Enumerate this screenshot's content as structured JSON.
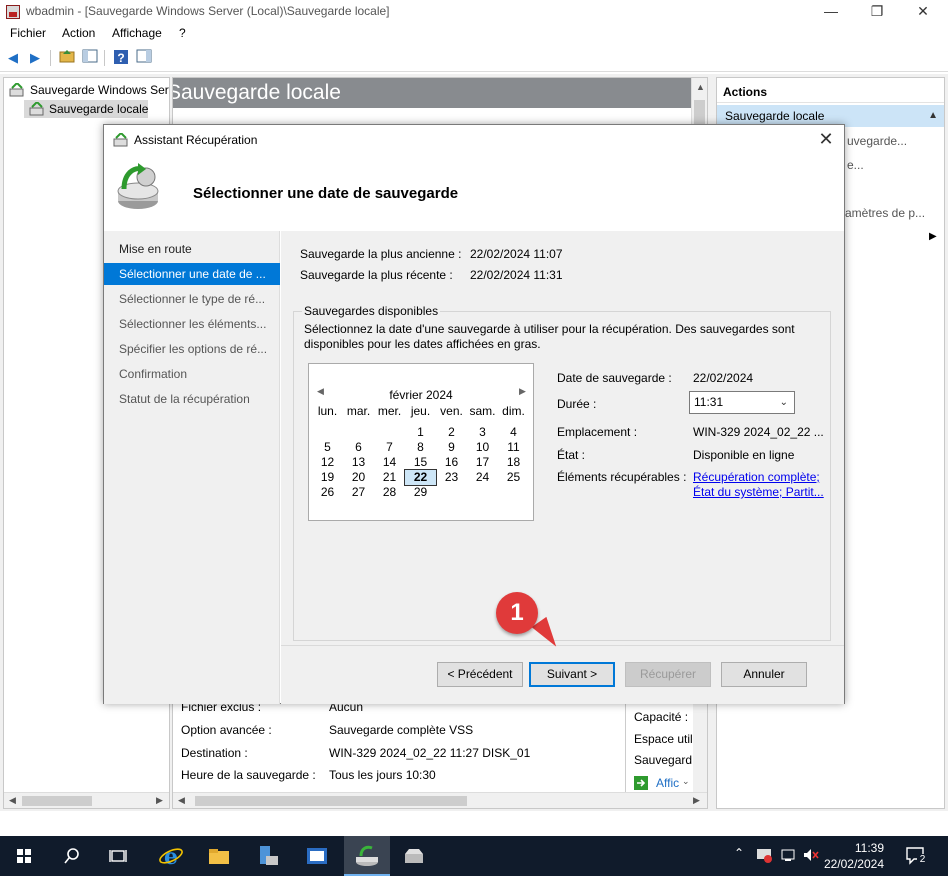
{
  "window": {
    "title": "wbadmin - [Sauvegarde Windows Server (Local)\\Sauvegarde locale]",
    "minimize": "—",
    "restore": "❐",
    "close": "✕"
  },
  "menu": {
    "file": "Fichier",
    "action": "Action",
    "view": "Affichage",
    "help": "?"
  },
  "tree": {
    "root": "Sauvegarde Windows Server (Local)",
    "child": "Sauvegarde locale"
  },
  "center": {
    "header": "Sauvegarde locale",
    "props": [
      {
        "label": "Fichier exclus :",
        "value": "Aucun"
      },
      {
        "label": "Option avancée :",
        "value": "Sauvegarde complète VSS"
      },
      {
        "label": "Destination :",
        "value": "WIN-329 2024_02_22 11:27 DISK_01"
      },
      {
        "label": "Heure de la sauvegarde :",
        "value": "Tous les jours 10:30"
      }
    ],
    "right_labels": [
      "Capacité :",
      "Espace util",
      "Sauvegard"
    ],
    "link": "Affic"
  },
  "actions": {
    "title": "Actions",
    "section": "Sauvegarde locale",
    "items": [
      "uvegarde...",
      "e...",
      "amètres de p..."
    ]
  },
  "dialog": {
    "title": "Assistant Récupération",
    "heading": "Sélectionner une date de sauvegarde",
    "steps": [
      "Mise en route",
      "Sélectionner une date de ...",
      "Sélectionner le type de ré...",
      "Sélectionner les éléments...",
      "Spécifier les options de ré...",
      "Confirmation",
      "Statut de la récupération"
    ],
    "oldest_label": "Sauvegarde la plus ancienne :",
    "oldest_value": "22/02/2024 11:07",
    "newest_label": "Sauvegarde la plus récente :",
    "newest_value": "22/02/2024 11:31",
    "group_title": "Sauvegardes disponibles",
    "group_desc_1": "Sélectionnez la date d'une sauvegarde à utiliser pour la récupération. Des sauvegardes sont",
    "group_desc_2": "disponibles pour les dates affichées en gras.",
    "calendar": {
      "month": "février 2024",
      "weekdays": [
        "lun.",
        "mar.",
        "mer.",
        "jeu.",
        "ven.",
        "sam.",
        "dim."
      ],
      "weeks": [
        [
          "",
          "",
          "",
          "1",
          "2",
          "3",
          "4"
        ],
        [
          "5",
          "6",
          "7",
          "8",
          "9",
          "10",
          "11"
        ],
        [
          "12",
          "13",
          "14",
          "15",
          "16",
          "17",
          "18"
        ],
        [
          "19",
          "20",
          "21",
          "22",
          "23",
          "24",
          "25"
        ],
        [
          "26",
          "27",
          "28",
          "29",
          "",
          "",
          ""
        ]
      ],
      "selected": "22"
    },
    "details": {
      "date_label": "Date de sauvegarde :",
      "date_value": "22/02/2024",
      "duree_label": "Durée :",
      "duree_value": "11:31",
      "location_label": "Emplacement :",
      "location_value": "WIN-329 2024_02_22 ...",
      "state_label": "État :",
      "state_value": "Disponible en ligne",
      "items_label": "Éléments récupérables :",
      "items_link_1": "Récupération complète;",
      "items_link_2": "État du système; Partit..."
    },
    "buttons": {
      "previous": "< Précédent",
      "next": "Suivant >",
      "recover": "Récupérer",
      "cancel": "Annuler"
    }
  },
  "annotation": {
    "number": "1"
  },
  "taskbar": {
    "time": "11:39",
    "date": "22/02/2024",
    "notifications": "2"
  }
}
